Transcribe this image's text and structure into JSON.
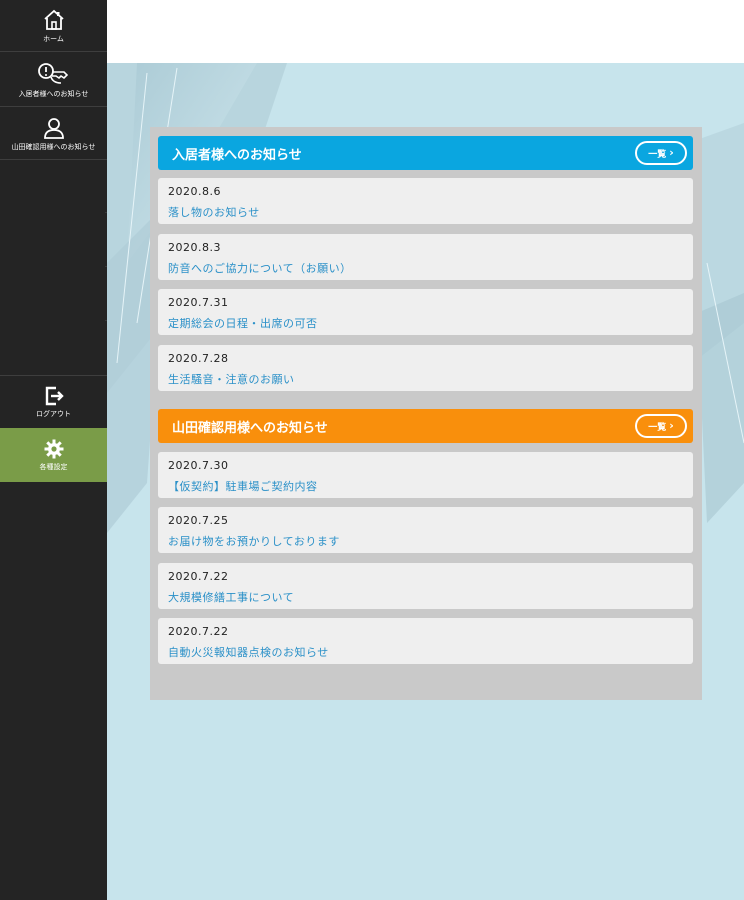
{
  "sidebar": {
    "items": [
      {
        "label": "ホーム",
        "icon": "home-icon"
      },
      {
        "label": "入居者様へのお知らせ",
        "icon": "key-notice-icon"
      },
      {
        "label": "山田確認用様へのお知らせ",
        "icon": "user-icon"
      },
      {
        "label": "ログアウト",
        "icon": "logout-icon"
      },
      {
        "label": "各種設定",
        "icon": "gear-icon"
      }
    ],
    "active_color": "#7a9c48"
  },
  "sections": [
    {
      "title": "入居者様へのお知らせ",
      "button_label": "一覧",
      "color": "#0aa6e0",
      "notices": [
        {
          "date": "2020.8.6",
          "title": "落し物のお知らせ"
        },
        {
          "date": "2020.8.3",
          "title": "防音へのご協力について（お願い）"
        },
        {
          "date": "2020.7.31",
          "title": "定期総会の日程・出席の可否"
        },
        {
          "date": "2020.7.28",
          "title": "生活騒音・注意のお願い"
        }
      ]
    },
    {
      "title": "山田確認用様へのお知らせ",
      "button_label": "一覧",
      "color": "#f98f0c",
      "notices": [
        {
          "date": "2020.7.30",
          "title": "【仮契約】駐車場ご契約内容"
        },
        {
          "date": "2020.7.25",
          "title": "お届け物をお預かりしております"
        },
        {
          "date": "2020.7.22",
          "title": "大規模修繕工事について"
        },
        {
          "date": "2020.7.22",
          "title": "自動火災報知器点検のお知らせ"
        }
      ]
    }
  ],
  "colors": {
    "sidebar_bg": "#242424",
    "page_bg": "#c7e4ec",
    "notice_title": "#2a90c8"
  }
}
